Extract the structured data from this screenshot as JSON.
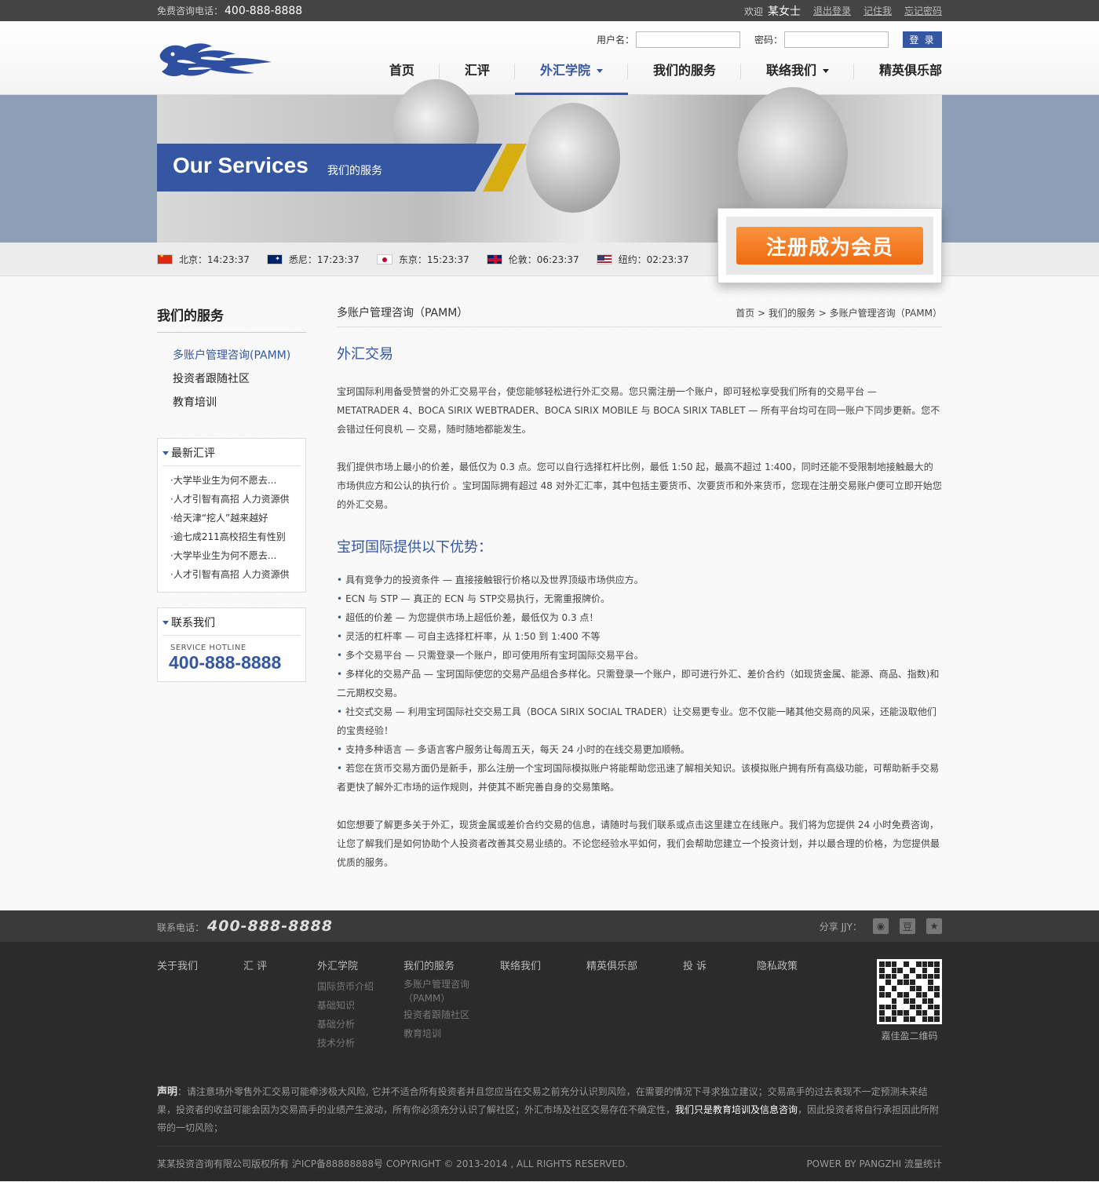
{
  "topbar": {
    "hotline_label": "免费咨询电话：",
    "hotline": "400-888-8888",
    "welcome": "欢迎",
    "username": "某女士",
    "logout": "退出登录",
    "remember": "记住我",
    "forgot": "忘记密码"
  },
  "login": {
    "user_label": "用户名：",
    "pass_label": "密码：",
    "button": "登 录"
  },
  "nav": {
    "items": [
      {
        "label": "首页"
      },
      {
        "label": "汇评"
      },
      {
        "label": "外汇学院"
      },
      {
        "label": "我们的服务"
      },
      {
        "label": "联络我们"
      },
      {
        "label": "精英俱乐部"
      }
    ]
  },
  "banner": {
    "title_en": "Our Services",
    "title_cn": "我们的服务",
    "register": "注册成为会员"
  },
  "clocks": [
    {
      "city": "北京：14:23:37"
    },
    {
      "city": "悉尼：17:23:37"
    },
    {
      "city": "东京：15:23:37"
    },
    {
      "city": "伦敦：06:23:37"
    },
    {
      "city": "纽约：02:23:37"
    }
  ],
  "sidebar": {
    "title": "我们的服务",
    "items": [
      "多账户管理咨询(PAMM)",
      "投资者跟随社区",
      "教育培训"
    ],
    "news_title": "最新汇评",
    "news": [
      "·大学毕业生为何不愿去...",
      "·人才引智有高招 人力资源供",
      "·给天津“挖人”越来越好",
      "·逾七成211高校招生有性别",
      "·大学毕业生为何不愿去...",
      "·人才引智有高招 人力资源供"
    ],
    "contact_title": "联系我们",
    "hotline_label": "SERVICE HOTLINE",
    "hotline": "400-888-8888"
  },
  "content": {
    "page_title": "多账户管理咨询（PAMM）",
    "breadcrumb": "首页 > 我们的服务 > 多账户管理咨询（PAMM）",
    "h1": "外汇交易",
    "p1": "宝珂国际利用备受赞誉的外汇交易平台，使您能够轻松进行外汇交易。您只需注册一个账户，即可轻松享受我们所有的交易平台 — METATRADER 4、BOCA SIRIX WEBTRADER、BOCA SIRIX MOBILE 与 BOCA SIRIX TABLET — 所有平台均可在同一账户下同步更新。您不会错过任何良机 — 交易，随时随地都能发生。",
    "p2": "我们提供市场上最小的价差，最低仅为 0.3 点。您可以自行选择杠杆比例，最低 1:50 起，最高不超过 1:400，同时还能不受限制地接触最大的市场供应方和公认的执行价 。宝珂国际拥有超过 48 对外汇汇率，其中包括主要货币、次要货币和外来货币，您现在注册交易账户便可立即开始您的外汇交易。",
    "h2": "宝珂国际提供以下优势：",
    "advantages": [
      "具有竞争力的投资条件 — 直接接触银行价格以及世界顶级市场供应方。",
      "ECN 与 STP — 真正的 ECN 与 STP交易执行，无需重报牌价。",
      "超低的价差 — 为您提供市场上超低价差，最低仅为 0.3 点！",
      "灵活的杠杆率 — 可自主选择杠杆率，从 1:50 到 1:400 不等",
      "多个交易平台 — 只需登录一个账户，即可使用所有宝珂国际交易平台。",
      "多样化的交易产品 — 宝珂国际使您的交易产品组合多样化。只需登录一个账户，即可进行外汇、差价合约（如现货金属、能源、商品、指数)和二元期权交易。",
      "社交式交易 — 利用宝珂国际社交交易工具（BOCA SIRIX SOCIAL TRADER）让交易更专业。您不仅能一睹其他交易商的风采，还能汲取他们的宝贵经验！",
      "支持多种语言 — 多语言客户服务让每周五天，每天 24 小时的在线交易更加顺畅。",
      "若您在货币交易方面仍是新手，那么注册一个宝珂国际模拟账户将能帮助您迅速了解相关知识。该模拟账户拥有所有高级功能，可帮助新手交易者更快了解外汇市场的运作规则，并使其不断完善自身的交易策略。"
    ],
    "p3": "如您想要了解更多关于外汇，现货金属或差价合约交易的信息，请随时与我们联系或点击这里建立在线账户。我们将为您提供 24 小时免费咨询，让您了解我们是如何协助个人投资者改善其交易业绩的。不论您经验水平如何，我们会帮助您建立一个投资计划，并以最合理的价格，为您提供最优质的服务。"
  },
  "footer": {
    "tel_label": "联系电话：",
    "tel": "400-888-8888",
    "share_label": "分享 JJY：",
    "columns": [
      {
        "title": "关于我们",
        "links": []
      },
      {
        "title": "汇  评",
        "links": []
      },
      {
        "title": "外汇学院",
        "links": [
          "国际货币介绍",
          "基础知识",
          "基础分析",
          "技术分析"
        ]
      },
      {
        "title": "我们的服务",
        "links": [
          "多账户管理咨询",
          "（PAMM）",
          "投资者跟随社区",
          "教育培训"
        ]
      },
      {
        "title": "联络我们",
        "links": []
      },
      {
        "title": "精英俱乐部",
        "links": []
      },
      {
        "title": "投  诉",
        "links": []
      },
      {
        "title": "隐私政策",
        "links": []
      }
    ],
    "qr_caption": "嘉佳盈二维码",
    "disclaimer_label": "声明",
    "disclaimer_a": "：请注意场外零售外汇交易可能牵涉极大风险, 它并不适合所有投资者并且您应当在交易之前充分认识到风险，在需要的情况下寻求独立建议；交易高手的过去表现不一定预测未来结果，投资者的收益可能会因为交易高手的业绩产生波动，所有你必须充分认识了解社区；外汇市场及社区交易存在不确定性，",
    "disclaimer_hl": "我们只是教育培训及信息咨询",
    "disclaimer_b": "，因此投资者将自行承担因此所附带的一切风险；",
    "copyright": "某某投资咨询有限公司版权所有 沪ICP备88888888号 COPYRIGHT © 2013-2014 , ALL RIGHTS RESERVED.",
    "powered": "POWER BY PANGZHI  流量统计"
  },
  "colors": {
    "brand": "#3556a1",
    "accent": "#ef6a10",
    "yellow": "#d6ae0f"
  }
}
